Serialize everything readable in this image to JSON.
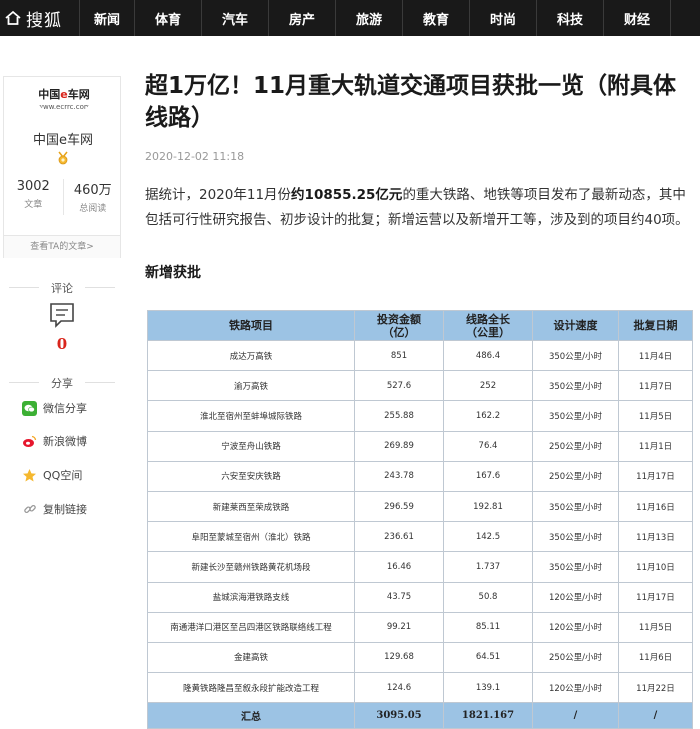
{
  "nav": {
    "logo_text": "搜狐",
    "items": [
      "新闻",
      "体育",
      "汽车",
      "房产",
      "旅游",
      "教育",
      "时尚",
      "科技",
      "财经"
    ]
  },
  "author": {
    "avatar_brand_pre": "中国",
    "avatar_brand_e": "e",
    "avatar_brand_post": "车网",
    "avatar_url": "www.ecrrc.com",
    "name": "中国e车网",
    "articles_count": "3002",
    "articles_label": "文章",
    "views_count": "460万",
    "views_label": "总阅读",
    "view_articles_link": "查看TA的文章>"
  },
  "comment": {
    "label": "评论",
    "count": "0"
  },
  "share": {
    "label": "分享",
    "items": [
      "微信分享",
      "新浪微博",
      "QQ空间",
      "复制链接"
    ]
  },
  "article": {
    "title": "超1万亿！11月重大轨道交通项目获批一览（附具体线路）",
    "date": "2020-12-02 11:18",
    "lead_pre": "据统计，2020年11月份",
    "lead_bold": "约10855.25亿元",
    "lead_post": "的重大铁路、地铁等项目发布了最新动态，其中包括可行性研究报告、初步设计的批复；新增运营以及新增开工等，涉及到的项目约40项。",
    "section_heading": "新增获批"
  },
  "table": {
    "headers": [
      "铁路项目",
      "投资金额\n（亿）",
      "线路全长\n（公里）",
      "设计速度",
      "批复日期"
    ],
    "rows": [
      [
        "成达万高铁",
        "851",
        "486.4",
        "350公里/小时",
        "11月4日"
      ],
      [
        "渝万高铁",
        "527.6",
        "252",
        "350公里/小时",
        "11月7日"
      ],
      [
        "淮北至宿州至蚌埠城际铁路",
        "255.88",
        "162.2",
        "350公里/小时",
        "11月5日"
      ],
      [
        "宁波至舟山铁路",
        "269.89",
        "76.4",
        "250公里/小时",
        "11月1日"
      ],
      [
        "六安至安庆铁路",
        "243.78",
        "167.6",
        "250公里/小时",
        "11月17日"
      ],
      [
        "新建莱西至荣成铁路",
        "296.59",
        "192.81",
        "350公里/小时",
        "11月16日"
      ],
      [
        "阜阳至蒙城至宿州（淮北）铁路",
        "236.61",
        "142.5",
        "350公里/小时",
        "11月13日"
      ],
      [
        "新建长沙至赣州铁路黄花机场段",
        "16.46",
        "1.737",
        "350公里/小时",
        "11月10日"
      ],
      [
        "盐城滨海港铁路支线",
        "43.75",
        "50.8",
        "120公里/小时",
        "11月17日"
      ],
      [
        "南通港洋口港区至吕四港区铁路联络线工程",
        "99.21",
        "85.11",
        "120公里/小时",
        "11月5日"
      ],
      [
        "金建高铁",
        "129.68",
        "64.51",
        "250公里/小时",
        "11月6日"
      ],
      [
        "隆黄铁路隆昌至叙永段扩能改造工程",
        "124.6",
        "139.1",
        "120公里/小时",
        "11月22日"
      ]
    ],
    "footer": [
      "汇总",
      "3095.05",
      "1821.167",
      "/",
      "/"
    ]
  },
  "colors": {
    "nav_bg": "#191919",
    "table_header_bg": "#9cc3e4",
    "accent_red": "#d9251c"
  },
  "icons": [
    "home-icon",
    "medal-icon",
    "comment-icon",
    "wechat-icon",
    "weibo-icon",
    "qzone-icon",
    "link-icon"
  ]
}
